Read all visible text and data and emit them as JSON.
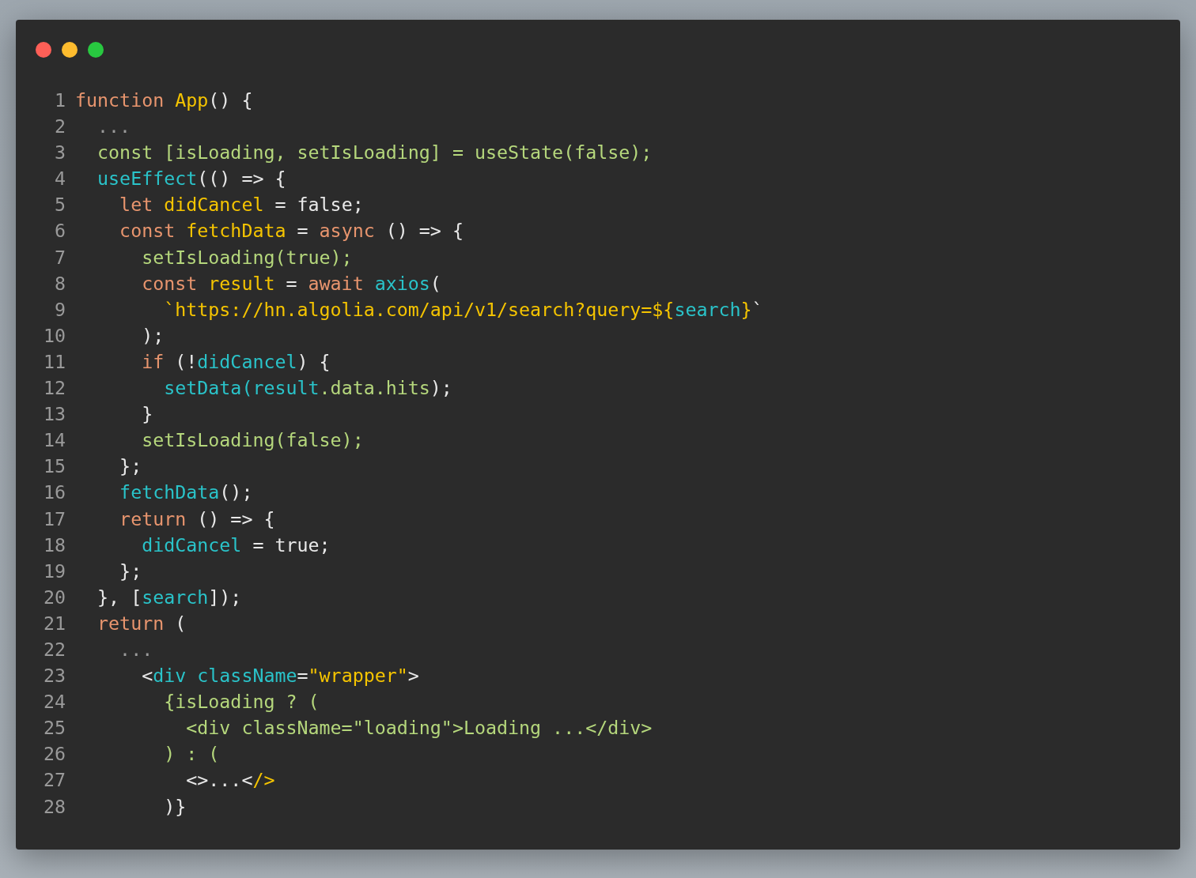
{
  "code": {
    "lines": [
      {
        "number": "1",
        "tokens": [
          {
            "text": "function ",
            "kind": "keyword"
          },
          {
            "text": "App",
            "kind": "name"
          },
          {
            "text": "() {",
            "kind": "plain"
          }
        ]
      },
      {
        "number": "2",
        "tokens": [
          {
            "text": "  ...",
            "kind": "dim"
          }
        ]
      },
      {
        "number": "3",
        "tokens": [
          {
            "text": "  const [isLoading, setIsLoading] = useState(false);",
            "kind": "green"
          }
        ]
      },
      {
        "number": "4",
        "tokens": [
          {
            "text": "  useEffect",
            "kind": "call"
          },
          {
            "text": "(() => {",
            "kind": "plain"
          }
        ]
      },
      {
        "number": "5",
        "tokens": [
          {
            "text": "    let ",
            "kind": "keyword"
          },
          {
            "text": "didCancel",
            "kind": "name"
          },
          {
            "text": " = false;",
            "kind": "plain"
          }
        ]
      },
      {
        "number": "6",
        "tokens": [
          {
            "text": "    const ",
            "kind": "keyword"
          },
          {
            "text": "fetchData",
            "kind": "name"
          },
          {
            "text": " = ",
            "kind": "plain"
          },
          {
            "text": "async",
            "kind": "keyword"
          },
          {
            "text": " () => {",
            "kind": "plain"
          }
        ]
      },
      {
        "number": "7",
        "tokens": [
          {
            "text": "      setIsLoading(true);",
            "kind": "green"
          }
        ]
      },
      {
        "number": "8",
        "tokens": [
          {
            "text": "      const ",
            "kind": "keyword"
          },
          {
            "text": "result",
            "kind": "name"
          },
          {
            "text": " = ",
            "kind": "plain"
          },
          {
            "text": "await ",
            "kind": "keyword"
          },
          {
            "text": "axios",
            "kind": "call"
          },
          {
            "text": "(",
            "kind": "plain"
          }
        ]
      },
      {
        "number": "9",
        "tokens": [
          {
            "text": "        `https://hn.algolia.com/api/v1/search?query=${",
            "kind": "name"
          },
          {
            "text": "search",
            "kind": "call"
          },
          {
            "text": "}",
            "kind": "name"
          },
          {
            "text": "`",
            "kind": "plain"
          }
        ]
      },
      {
        "number": "10",
        "tokens": [
          {
            "text": "      );",
            "kind": "plain"
          }
        ]
      },
      {
        "number": "11",
        "tokens": [
          {
            "text": "      if ",
            "kind": "keyword"
          },
          {
            "text": "(!",
            "kind": "plain"
          },
          {
            "text": "didCancel",
            "kind": "call"
          },
          {
            "text": ") {",
            "kind": "plain"
          }
        ]
      },
      {
        "number": "12",
        "tokens": [
          {
            "text": "        setData(result",
            "kind": "call"
          },
          {
            "text": ".data.hits",
            "kind": "green"
          },
          {
            "text": ");",
            "kind": "plain"
          }
        ]
      },
      {
        "number": "13",
        "tokens": [
          {
            "text": "      }",
            "kind": "plain"
          }
        ]
      },
      {
        "number": "14",
        "tokens": [
          {
            "text": "      setIsLoading(false);",
            "kind": "green"
          }
        ]
      },
      {
        "number": "15",
        "tokens": [
          {
            "text": "    };",
            "kind": "plain"
          }
        ]
      },
      {
        "number": "16",
        "tokens": [
          {
            "text": "    fetchData",
            "kind": "call"
          },
          {
            "text": "();",
            "kind": "plain"
          }
        ]
      },
      {
        "number": "17",
        "tokens": [
          {
            "text": "    return ",
            "kind": "keyword"
          },
          {
            "text": "() => {",
            "kind": "plain"
          }
        ]
      },
      {
        "number": "18",
        "tokens": [
          {
            "text": "      didCancel",
            "kind": "call"
          },
          {
            "text": " = true;",
            "kind": "plain"
          }
        ]
      },
      {
        "number": "19",
        "tokens": [
          {
            "text": "    };",
            "kind": "plain"
          }
        ]
      },
      {
        "number": "20",
        "tokens": [
          {
            "text": "  }, [",
            "kind": "plain"
          },
          {
            "text": "search",
            "kind": "call"
          },
          {
            "text": "]);",
            "kind": "plain"
          }
        ]
      },
      {
        "number": "21",
        "tokens": [
          {
            "text": "  return ",
            "kind": "keyword"
          },
          {
            "text": "(",
            "kind": "plain"
          }
        ]
      },
      {
        "number": "22",
        "tokens": [
          {
            "text": "    ...",
            "kind": "dim"
          }
        ]
      },
      {
        "number": "23",
        "tokens": [
          {
            "text": "      <",
            "kind": "plain"
          },
          {
            "text": "div className",
            "kind": "call"
          },
          {
            "text": "=",
            "kind": "plain"
          },
          {
            "text": "\"wrapper\"",
            "kind": "name"
          },
          {
            "text": ">",
            "kind": "plain"
          }
        ]
      },
      {
        "number": "24",
        "tokens": [
          {
            "text": "        {isLoading ? (",
            "kind": "green"
          }
        ]
      },
      {
        "number": "25",
        "tokens": [
          {
            "text": "          <div className=\"loading\">Loading ...</div>",
            "kind": "green"
          }
        ]
      },
      {
        "number": "26",
        "tokens": [
          {
            "text": "        ) : (",
            "kind": "green"
          }
        ]
      },
      {
        "number": "27",
        "tokens": [
          {
            "text": "          <>...<",
            "kind": "plain"
          },
          {
            "text": "/>",
            "kind": "name"
          }
        ]
      },
      {
        "number": "28",
        "tokens": [
          {
            "text": "        )}",
            "kind": "plain"
          }
        ]
      }
    ]
  }
}
